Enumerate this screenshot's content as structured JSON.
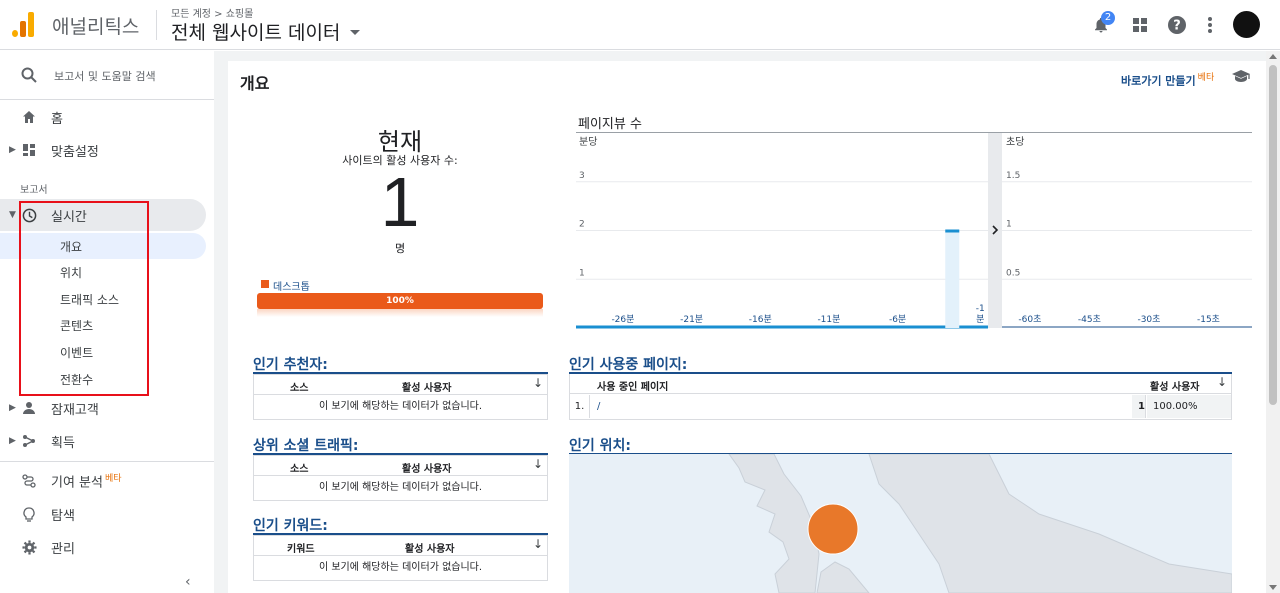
{
  "header": {
    "app_name": "애널리틱스",
    "breadcrumb": "모든 계정 > 쇼핑몰",
    "property": "전체 웹사이트 데이터",
    "notification_count": "2"
  },
  "sidebar": {
    "search_label": "보고서 및 도움말 검색",
    "home": "홈",
    "customization": "맞춤설정",
    "reports_section": "보고서",
    "realtime": "실시간",
    "realtime_items": [
      "개요",
      "위치",
      "트래픽 소스",
      "콘텐츠",
      "이벤트",
      "전환수"
    ],
    "audience": "잠재고객",
    "acquisition": "획득",
    "attribution": "기여 분석",
    "attribution_beta": "베타",
    "discover": "탐색",
    "admin": "관리"
  },
  "page": {
    "title": "개요",
    "shortcut": "바로가기 만들기",
    "shortcut_beta": "베타"
  },
  "active_users": {
    "label_now": "현재",
    "label_sub": "사이트의 활성 사용자 수:",
    "count": "1",
    "unit": "명",
    "device_legend": "데스크톱",
    "device_percent_label": "100%",
    "device_percent": 100,
    "device_color": "#ea5a1a"
  },
  "pageviews": {
    "title": "페이지뷰 수",
    "per_minute_label": "분당",
    "per_second_label": "초당",
    "chart_data": [
      {
        "type": "bar",
        "title": "분당",
        "y_ticks": [
          "3",
          "2",
          "1"
        ],
        "ylim": [
          0,
          4
        ],
        "x_ticks": [
          "-26분",
          "-21분",
          "-16분",
          "-11분",
          "-6분",
          "-1분"
        ],
        "x": [
          -1
        ],
        "values": [
          2
        ]
      },
      {
        "type": "bar",
        "title": "초당",
        "y_ticks": [
          "1.5",
          "1",
          "0.5"
        ],
        "ylim": [
          0,
          2
        ],
        "x_ticks": [
          "-60초",
          "-45초",
          "-30초",
          "-15초"
        ],
        "values": []
      }
    ]
  },
  "top_referrals": {
    "title": "인기 추천자:",
    "col1": "소스",
    "col2": "활성 사용자",
    "empty": "이 보기에 해당하는 데이터가 없습니다."
  },
  "top_social": {
    "title": "상위 소셜 트래픽:",
    "col1": "소스",
    "col2": "활성 사용자",
    "empty": "이 보기에 해당하는 데이터가 없습니다."
  },
  "top_keywords": {
    "title": "인기 키워드:",
    "col1": "키워드",
    "col2": "활성 사용자",
    "empty": "이 보기에 해당하는 데이터가 없습니다."
  },
  "top_pages": {
    "title": "인기 사용중 페이지:",
    "col1": "사용 중인 페이지",
    "col2": "활성 사용자",
    "rows": [
      {
        "rank": "1.",
        "page": "/",
        "count": "1",
        "percent": "100.00%"
      }
    ]
  },
  "top_locations": {
    "title": "인기 위치:"
  },
  "colors": {
    "accent": "#1a4e8a",
    "bar": "#1a8fd1",
    "orange": "#ea5a1a",
    "map_marker": "#e8782a"
  }
}
